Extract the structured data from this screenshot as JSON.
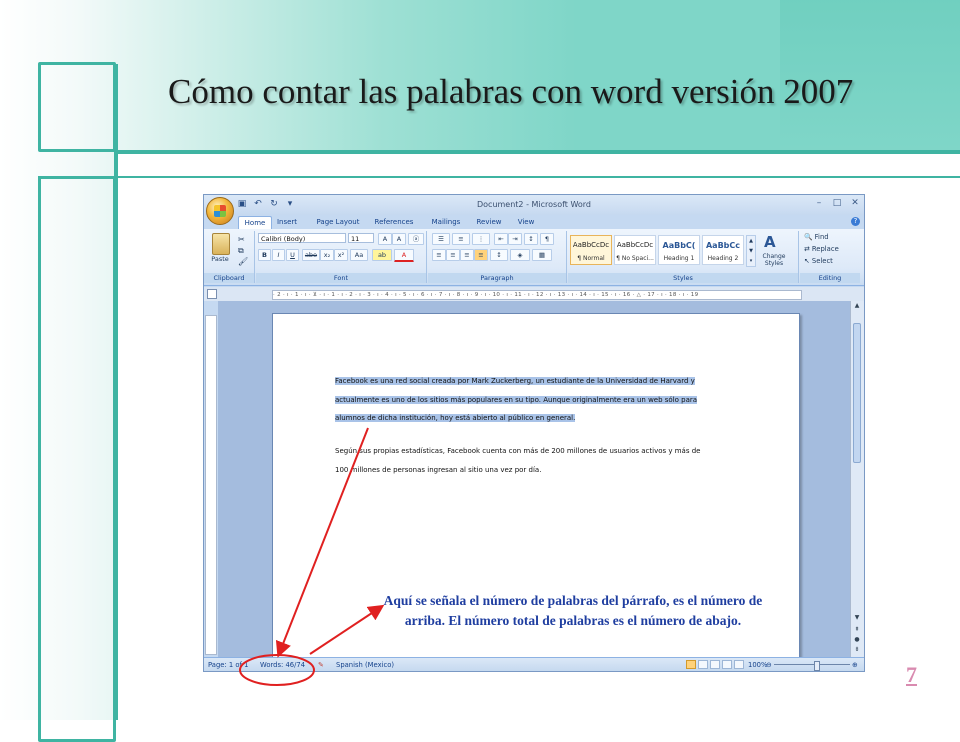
{
  "slide": {
    "title": "Cómo contar las palabras con word versión 2007",
    "page_number": "7",
    "annotation": "Aquí se señala el número de palabras del párrafo, es el número de arriba. El número total de palabras es el número de abajo.",
    "colors": {
      "frame": "#3fb4a2",
      "background": "#7fd6c8",
      "annotation_text": "#1f3ea0",
      "annotation_lines": "#e02020"
    }
  },
  "word": {
    "title": "Document2 - Microsoft Word",
    "quick_access_icons": [
      "save-icon",
      "undo-icon",
      "redo-icon",
      "customize-icon"
    ],
    "tabs": [
      "Home",
      "Insert",
      "Page Layout",
      "References",
      "Mailings",
      "Review",
      "View"
    ],
    "active_tab": "Home",
    "ribbon": {
      "clipboard": {
        "label": "Clipboard",
        "paste": "Paste"
      },
      "font": {
        "label": "Font",
        "font_name": "Calibri (Body)",
        "font_size": "11",
        "bold": "B",
        "italic": "I",
        "underline": "U",
        "strike": "abe",
        "subscript": "x₂",
        "superscript": "x²",
        "change_case": "Aa",
        "highlight": "ab",
        "font_color": "A"
      },
      "paragraph": {
        "label": "Paragraph"
      },
      "styles": {
        "label": "Styles",
        "items": [
          {
            "sample": "AaBbCcDc",
            "name": "¶ Normal"
          },
          {
            "sample": "AaBbCcDc",
            "name": "¶ No Spaci..."
          },
          {
            "sample": "AaBbC(",
            "name": "Heading 1"
          },
          {
            "sample": "AaBbCc",
            "name": "Heading 2"
          }
        ],
        "change_styles": "Change Styles"
      },
      "editing": {
        "label": "Editing",
        "find": "Find",
        "replace": "Replace",
        "select": "Select"
      }
    },
    "ruler_text": "· 2 · ı · 1 · ı · ⊻ · ı · 1 · ı · 2 · ı · 3 · ı · 4 · ı · 5 · ı · 6 · ı · 7 · ı · 8 · ı · 9 · ı · 10 · ı · 11 · ı · 12 · ı · 13 · ı · 14 · ı · 15 · ı · 16 · △ · 17 · ı · 18 · ı · 19",
    "document": {
      "paragraph1": [
        "Facebook es una red social creada por Mark Zuckerberg, un estudiante de la Universidad de Harvard y",
        "actualmente es uno de los sitios más populares en su tipo. Aunque originalmente era un web sólo para",
        "alumnos de dicha institución, hoy está abierto al público en general."
      ],
      "paragraph2": [
        "Según sus propias estadísticas, Facebook cuenta con más de 200 millones de usuarios activos y más de",
        "100 millones de personas ingresan al sitio una vez por día."
      ]
    },
    "statusbar": {
      "page": "Page: 1 of 1",
      "words": "Words: 46/74",
      "language": "Spanish (Mexico)",
      "zoom": "100%"
    }
  }
}
